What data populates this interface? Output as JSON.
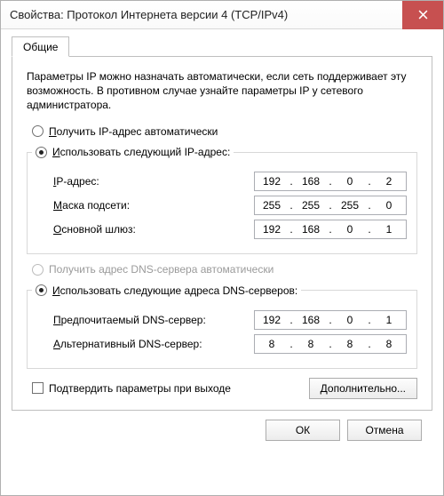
{
  "window": {
    "title": "Свойства: Протокол Интернета версии 4 (TCP/IPv4)"
  },
  "tab": {
    "label": "Общие"
  },
  "description": "Параметры IP можно назначать автоматически, если сеть поддерживает эту возможность. В противном случае узнайте параметры IP у сетевого администратора.",
  "ip_section": {
    "auto_label_pre": "П",
    "auto_label_rest": "олучить IP-адрес автоматически",
    "manual_label_pre": "И",
    "manual_label_rest": "спользовать следующий IP-адрес:",
    "ip_label_pre": "I",
    "ip_label_rest": "P-адрес:",
    "mask_label_pre": "М",
    "mask_label_rest": "аска подсети:",
    "gw_label_pre": "О",
    "gw_label_rest": "сновной шлюз:",
    "ip": {
      "o1": "192",
      "o2": "168",
      "o3": "0",
      "o4": "2"
    },
    "mask": {
      "o1": "255",
      "o2": "255",
      "o3": "255",
      "o4": "0"
    },
    "gw": {
      "o1": "192",
      "o2": "168",
      "o3": "0",
      "o4": "1"
    }
  },
  "dns_section": {
    "auto_label": "Получить адрес DNS-сервера автоматически",
    "manual_label_pre": "И",
    "manual_label_rest": "спользовать следующие адреса DNS-серверов:",
    "pref_label_pre": "П",
    "pref_label_rest": "редпочитаемый DNS-сервер:",
    "alt_label_pre": "А",
    "alt_label_rest": "льтернативный DNS-сервер:",
    "pref": {
      "o1": "192",
      "o2": "168",
      "o3": "0",
      "o4": "1"
    },
    "alt": {
      "o1": "8",
      "o2": "8",
      "o3": "8",
      "o4": "8"
    }
  },
  "validate_checkbox_label": "Подтвердить параметры при выходе",
  "buttons": {
    "advanced_pre": "Д",
    "advanced_rest": "ополнительно...",
    "ok": "ОК",
    "cancel": "Отмена"
  }
}
